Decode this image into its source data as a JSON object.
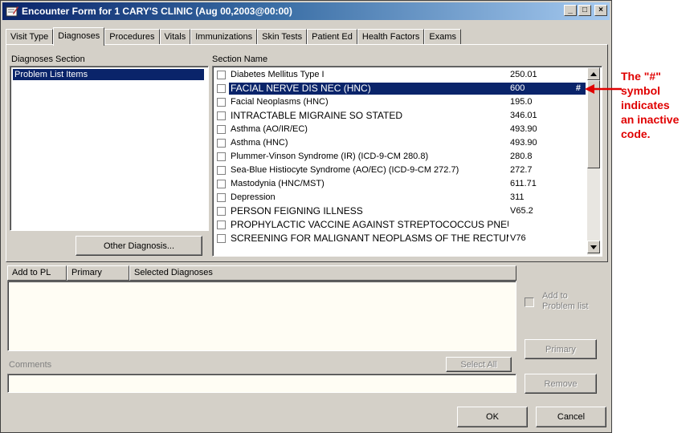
{
  "window": {
    "title": "Encounter Form for 1 CARY'S CLINIC  (Aug 00,2003@00:00)",
    "min_label": "_",
    "max_label": "□",
    "close_label": "×"
  },
  "tabs": [
    {
      "label": "Visit Type",
      "active": false
    },
    {
      "label": "Diagnoses",
      "active": true
    },
    {
      "label": "Procedures",
      "active": false
    },
    {
      "label": "Vitals",
      "active": false
    },
    {
      "label": "Immunizations",
      "active": false
    },
    {
      "label": "Skin Tests",
      "active": false
    },
    {
      "label": "Patient Ed",
      "active": false
    },
    {
      "label": "Health Factors",
      "active": false
    },
    {
      "label": "Exams",
      "active": false
    }
  ],
  "diagnoses_section": {
    "label": "Diagnoses Section",
    "items": [
      "Problem List Items"
    ]
  },
  "section_name": {
    "label": "Section Name",
    "rows": [
      {
        "name": "Diabetes Mellitus Type I",
        "code": "250.01",
        "flag": "",
        "selected": false,
        "caps": false
      },
      {
        "name": "FACIAL NERVE DIS NEC (HNC)",
        "code": "600",
        "flag": "#",
        "selected": true,
        "caps": true
      },
      {
        "name": "Facial Neoplasms (HNC)",
        "code": "195.0",
        "flag": "",
        "selected": false,
        "caps": false
      },
      {
        "name": "INTRACTABLE MIGRAINE SO STATED",
        "code": "346.01",
        "flag": "",
        "selected": false,
        "caps": true
      },
      {
        "name": "Asthma (AO/IR/EC)",
        "code": "493.90",
        "flag": "",
        "selected": false,
        "caps": false
      },
      {
        "name": "Asthma (HNC)",
        "code": "493.90",
        "flag": "",
        "selected": false,
        "caps": false
      },
      {
        "name": "Plummer-Vinson Syndrome (IR) (ICD-9-CM 280.8)",
        "code": "280.8",
        "flag": "",
        "selected": false,
        "caps": false
      },
      {
        "name": "Sea-Blue Histiocyte Syndrome (AO/EC) (ICD-9-CM 272.7)",
        "code": "272.7",
        "flag": "",
        "selected": false,
        "caps": false
      },
      {
        "name": "Mastodynia (HNC/MST)",
        "code": "611.71",
        "flag": "",
        "selected": false,
        "caps": false
      },
      {
        "name": "Depression",
        "code": "311",
        "flag": "",
        "selected": false,
        "caps": false
      },
      {
        "name": "PERSON FEIGNING ILLNESS",
        "code": "V65.2",
        "flag": "",
        "selected": false,
        "caps": true
      },
      {
        "name": "PROPHYLACTIC VACCINE AGAINST STREPTOCOCCUS PNEUMONIAE & IN",
        "code": "",
        "flag": "",
        "selected": false,
        "caps": true
      },
      {
        "name": "SCREENING FOR MALIGNANT NEOPLASMS OF THE RECTUM",
        "code": "V76",
        "flag": "",
        "selected": false,
        "caps": true
      }
    ]
  },
  "buttons": {
    "other_diagnosis": "Other Diagnosis...",
    "select_all": "Select All",
    "primary": "Primary",
    "remove": "Remove",
    "ok": "OK",
    "cancel": "Cancel"
  },
  "selected_grid": {
    "headers": [
      "Add to PL",
      "Primary",
      "Selected Diagnoses"
    ]
  },
  "add_to_problem_list": {
    "line1": "Add to",
    "line2": "Problem list"
  },
  "comments": {
    "label": "Comments",
    "value": ""
  },
  "annotation": {
    "lines": [
      "The \"#\"",
      "symbol",
      "indicates",
      "an inactive",
      "code."
    ],
    "color": "#e00000"
  },
  "colors": {
    "selection": "#0a246a",
    "face": "#d4d0c8",
    "input_bg": "#fffdf4"
  }
}
